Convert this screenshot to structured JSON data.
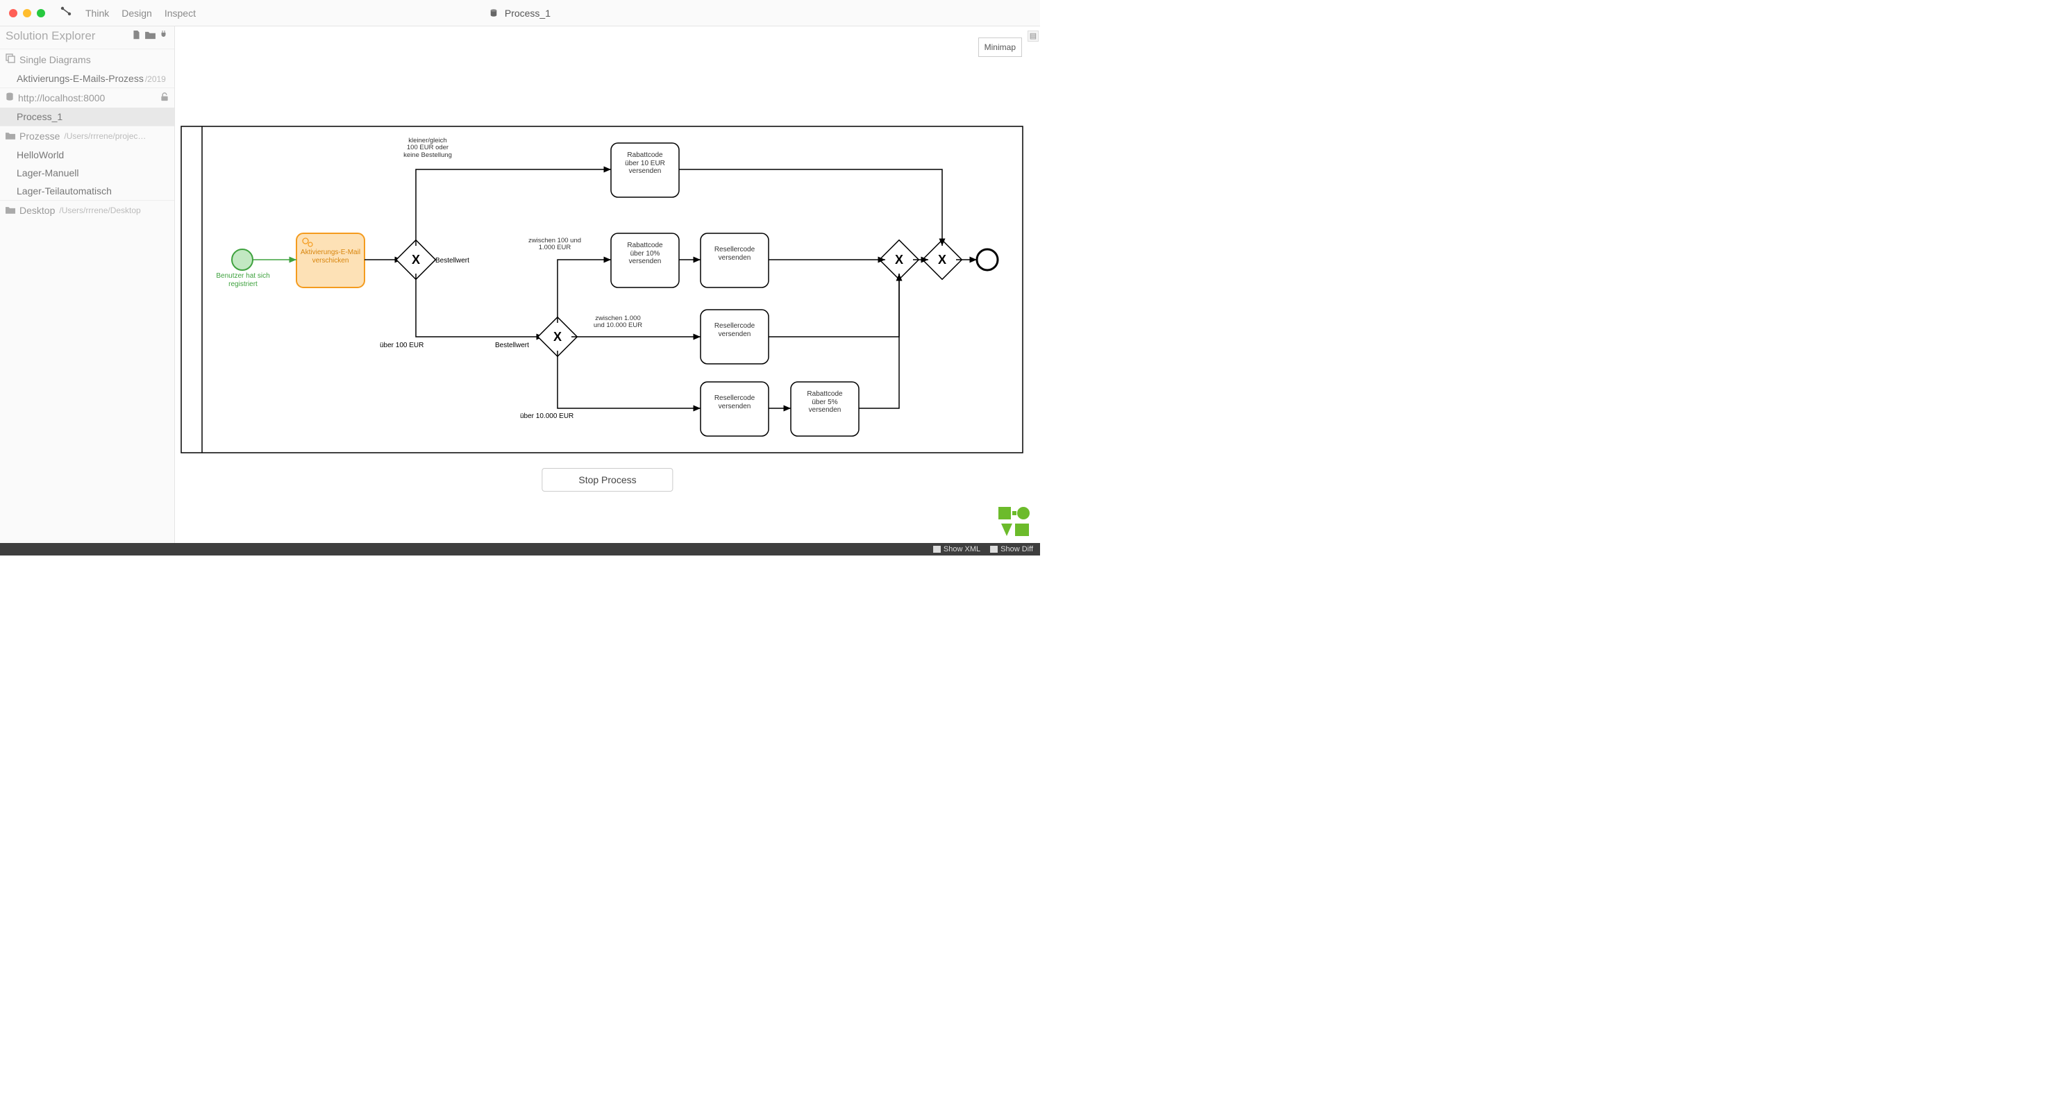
{
  "titlebar": {
    "menus": [
      "Think",
      "Design",
      "Inspect"
    ],
    "title": "Process_1"
  },
  "sidebar": {
    "header": "Solution Explorer",
    "sections": [
      {
        "icon": "stack",
        "label": "Single Diagrams",
        "items": [
          {
            "label": "Aktivierungs-E-Mails-Prozess",
            "meta": "/2019"
          }
        ]
      },
      {
        "icon": "database",
        "label": "http://localhost:8000",
        "trailing": "unlock",
        "items": [
          {
            "label": "Process_1",
            "selected": true
          }
        ]
      },
      {
        "icon": "folder",
        "label": "Prozesse",
        "meta": "/Users/rrrene/projects/pe…",
        "items": [
          {
            "label": "HelloWorld"
          },
          {
            "label": "Lager-Manuell"
          },
          {
            "label": "Lager-Teilautomatisch"
          }
        ]
      },
      {
        "icon": "folder",
        "label": "Desktop",
        "meta": "/Users/rrrene/Desktop",
        "items": []
      }
    ]
  },
  "canvas": {
    "minimap": "Minimap",
    "stop_button": "Stop Process",
    "start_event": "Benutzer hat sich registriert",
    "task_activate": "Aktivierungs-E-Mail verschicken",
    "gateway1_label": "Bestellwert",
    "gateway2_label": "Bestellwert",
    "cond_small": "kleiner/gleich\n100 EUR oder\nkeine Bestellung",
    "cond_over100": "über 100 EUR",
    "cond_100_1000": "zwischen 100 und\n1.000 EUR",
    "cond_1000_10000": "zwischen 1.000\nund 10.000 EUR",
    "cond_over10000": "über 10.000 EUR",
    "task_rebate10eur": "Rabattcode\nüber 10 EUR\nversenden",
    "task_rebate10pct": "Rabattcode\nüber 10%\nversenden",
    "task_reseller1": "Resellercode\nversenden",
    "task_reseller2": "Resellercode\nversenden",
    "task_reseller3": "Resellercode\nversenden",
    "task_rebate5pct": "Rabattcode\nüber 5%\nversenden"
  },
  "statusbar": {
    "show_xml": "Show XML",
    "show_diff": "Show Diff"
  }
}
